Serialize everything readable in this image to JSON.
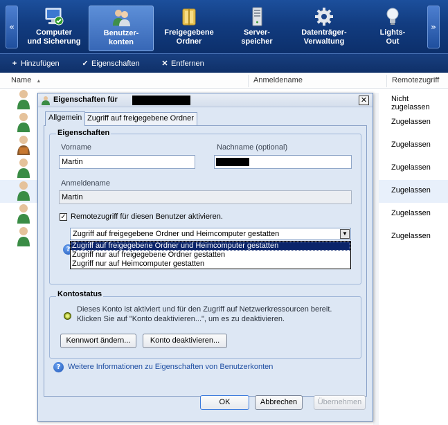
{
  "navbar": {
    "left_arrow": "«",
    "right_arrow": "»",
    "items": [
      {
        "label": "Computer\nund Sicherung",
        "icon": "monitor-check-icon"
      },
      {
        "label": "Benutzer-\nkonten",
        "icon": "users-icon"
      },
      {
        "label": "Freigegebene\nOrdner",
        "icon": "shared-folder-icon"
      },
      {
        "label": "Server-\nspeicher",
        "icon": "server-icon"
      },
      {
        "label": "Datenträger-\nVerwaltung",
        "icon": "gear-icon"
      },
      {
        "label": "Lights-\nOut",
        "icon": "lightbulb-icon"
      }
    ]
  },
  "toolbar": {
    "add": {
      "icon": "+",
      "label": "Hinzufügen"
    },
    "properties": {
      "icon": "✓",
      "label": "Eigenschaften"
    },
    "remove": {
      "icon": "✕",
      "label": "Entfernen"
    }
  },
  "list": {
    "columns": {
      "name": "Name",
      "sort": "▲",
      "login": "Anmeldename",
      "remote": "Remotezugriff"
    },
    "rows": [
      {
        "remote": "Nicht zugelassen",
        "avatar": "user-avatar-icon"
      },
      {
        "remote": "Zugelassen",
        "avatar": "user-avatar-icon"
      },
      {
        "remote": "Zugelassen",
        "avatar": "guest-briefcase-icon"
      },
      {
        "remote": "Zugelassen",
        "avatar": "user-avatar-icon"
      },
      {
        "remote": "Zugelassen",
        "avatar": "user-avatar-icon"
      },
      {
        "remote": "Zugelassen",
        "avatar": "user-avatar-icon"
      },
      {
        "remote": "Zugelassen",
        "avatar": "user-avatar-icon"
      }
    ]
  },
  "dialog": {
    "title": "Eigenschaften für",
    "close": "✕",
    "tabs": [
      "Allgemein",
      "Zugriff auf freigegebene Ordner"
    ],
    "properties_group": "Eigenschaften",
    "first_name_label": "Vorname",
    "first_name_value": "Martin",
    "last_name_label": "Nachname (optional)",
    "login_label": "Anmeldename",
    "login_value": "Martin",
    "remote_checkbox_label": "Remotezugriff für diesen Benutzer aktivieren.",
    "remote_checked": "✓",
    "access_selected": "Zugriff auf freigegebene Ordner und Heimcomputer gestatten",
    "access_options": [
      "Zugriff auf freigegebene Ordner und Heimcomputer gestatten",
      "Zugriff nur auf freigegebene Ordner gestatten",
      "Zugriff nur auf Heimcomputer gestatten"
    ],
    "account_group": "Kontostatus",
    "account_text": "Dieses Konto ist aktiviert und für den Zugriff auf Netzwerkressourcen bereit. Klicken Sie auf \"Konto deaktivieren...\", um es zu deaktivieren.",
    "change_password": "Kennwort ändern...",
    "deactivate": "Konto deaktivieren...",
    "more_info": "Weitere Informationen zu Eigenschaften von Benutzerkonten",
    "ok": "OK",
    "cancel": "Abbrechen",
    "apply": "Übernehmen"
  }
}
